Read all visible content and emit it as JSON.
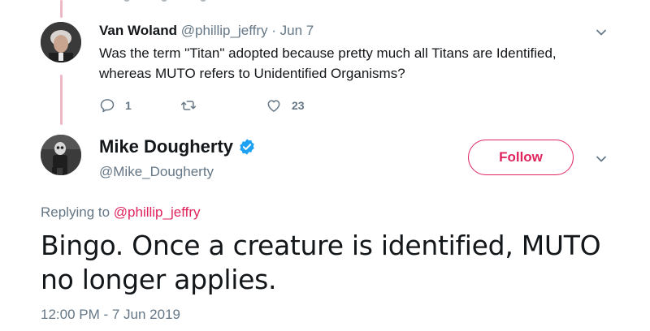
{
  "reply": {
    "name": "Van Woland",
    "handle": "@phillip_jeffry",
    "separator": " · ",
    "date": "Jun 7",
    "text": "Was the term \"Titan\" adopted because pretty much all Titans are Identified, whereas MUTO refers to Unidentified Organisms?",
    "reply_count": "1",
    "retweet_count": "",
    "like_count": "23"
  },
  "main": {
    "name": "Mike Dougherty",
    "handle": "@Mike_Dougherty",
    "follow_label": "Follow",
    "replying_prefix": "Replying to ",
    "replying_handle": "@phillip_jeffry",
    "text": "Bingo. Once a creature is identified, MUTO no longer applies.",
    "timestamp": "12:00 PM - 7 Jun 2019"
  },
  "colors": {
    "accent": "#e0245e",
    "verified": "#1da1f2",
    "muted_text": "#657786",
    "thread_line": "#eeb9c6"
  },
  "icons": [
    "reply-icon",
    "retweet-icon",
    "like-icon",
    "chevron-down-icon",
    "verified-badge-icon"
  ]
}
